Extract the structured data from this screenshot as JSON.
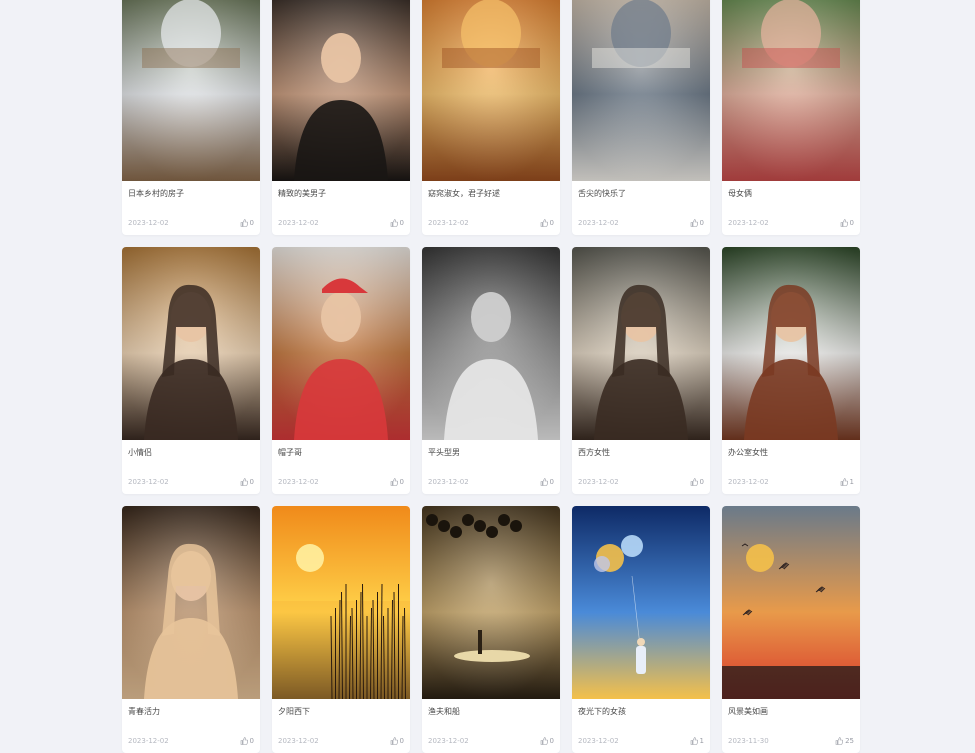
{
  "gallery": {
    "cards": [
      {
        "title": "日本乡村的房子",
        "date": "2023-12-02",
        "likes": "0",
        "image": "japanese-village-house",
        "palette": [
          "#5d6b4a",
          "#e9ecef",
          "#8a6a4b"
        ]
      },
      {
        "title": "精致的美男子",
        "date": "2023-12-02",
        "likes": "0",
        "image": "handsome-man-portrait",
        "palette": [
          "#2b2420",
          "#c99a7b",
          "#1a1614"
        ]
      },
      {
        "title": "窈窕淑女，君子好逑",
        "date": "2023-12-02",
        "likes": "0",
        "image": "woman-in-orange-dress",
        "palette": [
          "#e07d2c",
          "#f7c26b",
          "#9b4e1f"
        ]
      },
      {
        "title": "舌尖的快乐了",
        "date": "2023-12-02",
        "likes": "0",
        "image": "couple-at-table",
        "palette": [
          "#d8c7b3",
          "#6d7b8a",
          "#f2efe9"
        ]
      },
      {
        "title": "母女俩",
        "date": "2023-12-02",
        "likes": "0",
        "image": "mother-daughter-garden",
        "palette": [
          "#5a8a4a",
          "#e8b4a0",
          "#c84a4a"
        ]
      },
      {
        "title": "小情侣",
        "date": "2023-12-02",
        "likes": "0",
        "image": "anime-couple",
        "palette": [
          "#b07a3a",
          "#f4d9b8",
          "#3a2a22"
        ]
      },
      {
        "title": "帽子哥",
        "date": "2023-12-02",
        "likes": "0",
        "image": "man-red-cap",
        "palette": [
          "#f1ede8",
          "#c87a3f",
          "#d8383b"
        ]
      },
      {
        "title": "平头型男",
        "date": "2023-12-02",
        "likes": "0",
        "image": "man-bw-portrait",
        "palette": [
          "#3a3a3a",
          "#9a9a9a",
          "#e8e8e8"
        ]
      },
      {
        "title": "西方女性",
        "date": "2023-12-02",
        "likes": "0",
        "image": "woman-stone-wall",
        "palette": [
          "#5a5a52",
          "#e6d9c6",
          "#3a2b22"
        ]
      },
      {
        "title": "办公室女性",
        "date": "2023-12-02",
        "likes": "1",
        "image": "woman-white-shirt",
        "palette": [
          "#2f4a2a",
          "#f4f4f2",
          "#7a3a22"
        ]
      },
      {
        "title": "青春活力",
        "date": "2023-12-02",
        "likes": "0",
        "image": "woman-hair-closeup",
        "palette": [
          "#3a2a1e",
          "#c49a72",
          "#e8c49a"
        ]
      },
      {
        "title": "夕阳西下",
        "date": "2023-12-02",
        "likes": "0",
        "image": "sunset-reeds",
        "palette": [
          "#f08a1a",
          "#ffd24a",
          "#3a2a1a"
        ]
      },
      {
        "title": "渔夫和船",
        "date": "2023-12-02",
        "likes": "0",
        "image": "fisherman-boat",
        "palette": [
          "#4a3a22",
          "#c9a86a",
          "#2a2014"
        ]
      },
      {
        "title": "夜光下的女孩",
        "date": "2023-12-02",
        "likes": "1",
        "image": "girl-planets-night",
        "palette": [
          "#0e2a66",
          "#4a8ad8",
          "#f4c04a"
        ]
      },
      {
        "title": "风景美如画",
        "date": "2023-11-30",
        "likes": "25",
        "image": "sunset-birds-sky",
        "palette": [
          "#6a7a8a",
          "#e89a4a",
          "#d8382a"
        ]
      }
    ]
  }
}
